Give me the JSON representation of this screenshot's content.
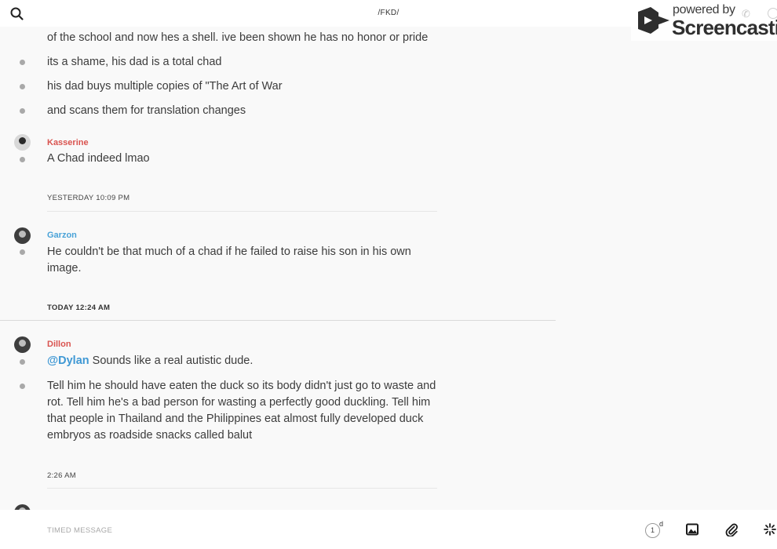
{
  "header": {
    "channel_title": "/FKD/"
  },
  "watermark": {
    "powered_by": "powered by",
    "brand": "Screencastify"
  },
  "messages": {
    "m1_line": "of the school and now hes a shell. ive been shown he has no honor or pride",
    "m2": "its a shame, his dad is a total chad",
    "m3": "his dad buys multiple copies of \"The Art of War",
    "m4": "and scans them for translation changes",
    "kasserine": {
      "author": "Kasserine",
      "text": "A Chad indeed lmao"
    },
    "ts1": "YESTERDAY 10:09 PM",
    "garzon": {
      "author": "Garzon",
      "line1": "He couldn't be that much of a chad if he failed to raise his son in his own",
      "line2": "image."
    },
    "ts2": "TODAY 12:24 AM",
    "dillon": {
      "author": "Dillon",
      "mention": "@Dylan",
      "text1": " Sounds like a real autistic dude.",
      "p2_l1": "Tell him he should have eaten the duck so its body didn't just go to waste and",
      "p2_l2": "rot. Tell him he's a bad person for wasting a perfectly good duckling. Tell him",
      "p2_l3": "that people in Thailand and the Philippines eat almost fully developed duck",
      "p2_l4": "embryos as roadside snacks called balut"
    },
    "ts3": "2:26 AM"
  },
  "composer": {
    "placeholder": "TIMED MESSAGE",
    "timer_value": "1",
    "timer_unit": "d"
  },
  "icons": {
    "search": "search-icon",
    "image": "image-icon",
    "attach": "paperclip-icon",
    "sparkle": "sparkle-icon"
  }
}
